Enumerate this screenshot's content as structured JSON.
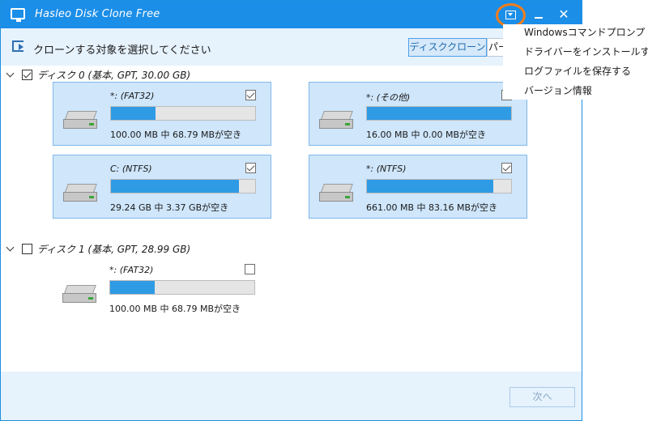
{
  "window": {
    "title": "Hasleo Disk Clone Free",
    "close_glyph": "✕"
  },
  "header": {
    "instruction": "クローンする対象を選択してください",
    "mode_buttons": [
      "ディスククローン",
      "パー"
    ]
  },
  "disks": [
    {
      "label": "ディスク 0 (基本, GPT, 30.00 GB)",
      "checked": true,
      "partitions": [
        {
          "name": "*: (FAT32)",
          "size": "100.00 MB 中 68.79 MBが空き",
          "used_fraction": 0.31,
          "checked": true,
          "selected": true
        },
        {
          "name": "*: (その他)",
          "size": "16.00 MB 中 0.00 MBが空き",
          "used_fraction": 1.0,
          "checked": false,
          "selected": true
        },
        {
          "name": "C: (NTFS)",
          "size": "29.24 GB 中 3.37 GBが空き",
          "used_fraction": 0.885,
          "checked": true,
          "selected": true
        },
        {
          "name": "*: (NTFS)",
          "size": "661.00 MB 中 83.16 MBが空き",
          "used_fraction": 0.874,
          "checked": true,
          "selected": true
        }
      ]
    },
    {
      "label": "ディスク 1 (基本, GPT, 28.99 GB)",
      "checked": false,
      "partitions": [
        {
          "name": "*: (FAT32)",
          "size": "100.00 MB 中 68.79 MBが空き",
          "used_fraction": 0.31,
          "checked": false,
          "selected": false
        }
      ]
    }
  ],
  "footer": {
    "next_label": "次へ"
  },
  "menu": {
    "items": [
      "Windowsコマンドプロンプト",
      "ドライバーをインストールする",
      "ログファイルを保存する",
      "バージョン情報"
    ]
  },
  "colors": {
    "titlebar": "#1b8ee8",
    "accent_ring": "#f07d1a",
    "bar_fill": "#2f9be4",
    "selected_bg": "#cfe6fb"
  }
}
